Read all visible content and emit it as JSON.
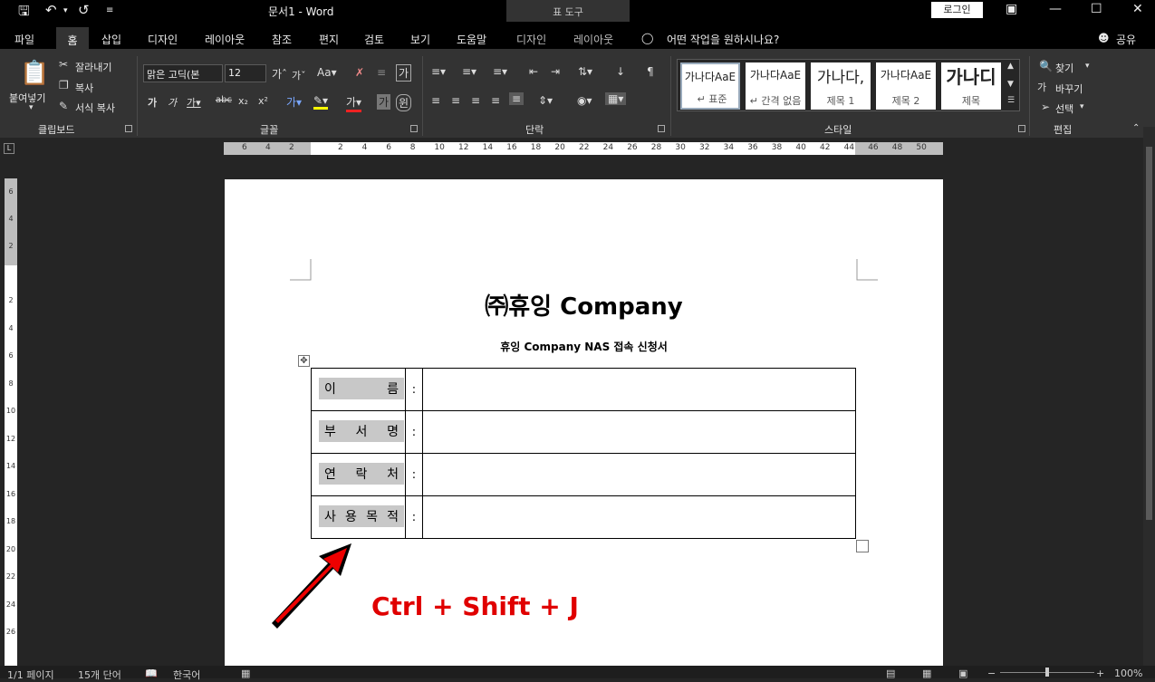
{
  "titlebar": {
    "title": "문서1 - Word",
    "context_tab": "표 도구",
    "login": "로그인"
  },
  "tabs": {
    "file": "파일",
    "home": "홈",
    "insert": "삽입",
    "design": "디자인",
    "layout": "레이아웃",
    "references": "참조",
    "mailings": "편지",
    "review": "검토",
    "view": "보기",
    "help": "도움말",
    "table_design": "디자인",
    "table_layout": "레이아웃",
    "tell_me": "어떤 작업을 원하시나요?",
    "share": "공유"
  },
  "ribbon": {
    "clipboard": {
      "paste": "붙여넣기",
      "cut": "잘라내기",
      "copy": "복사",
      "format_painter": "서식 복사",
      "label": "클립보드"
    },
    "font": {
      "name": "맑은 고딕(본",
      "size": "12",
      "label": "글꼴"
    },
    "paragraph": {
      "label": "단락"
    },
    "styles": {
      "label": "스타일",
      "items": [
        {
          "preview": "가나다AaE",
          "name": "↵ 표준"
        },
        {
          "preview": "가나다AaE",
          "name": "↵ 간격 없음"
        },
        {
          "preview": "가나다,",
          "name": "제목 1"
        },
        {
          "preview": "가나다AaE",
          "name": "제목 2"
        },
        {
          "preview": "가나디",
          "name": "제목"
        }
      ]
    },
    "editing": {
      "find": "찾기",
      "replace": "바꾸기",
      "select": "선택",
      "label": "편집"
    }
  },
  "ruler": {
    "h_left_ticks": [
      "6",
      "4",
      "2"
    ],
    "h_right_ticks": [
      "2",
      "4",
      "6",
      "8",
      "10",
      "12",
      "14",
      "16",
      "18",
      "20",
      "22",
      "24",
      "26",
      "28",
      "30",
      "32",
      "34",
      "36",
      "38",
      "40",
      "42",
      "44",
      "46",
      "48",
      "50"
    ],
    "v_ticks": [
      "6",
      "4",
      "2",
      "2",
      "4",
      "6",
      "8",
      "10",
      "12",
      "14",
      "16",
      "18",
      "20",
      "22",
      "24",
      "26"
    ]
  },
  "document": {
    "title": "㈜휴잉  Company",
    "subtitle": "휴잉 Company NAS 접속 신청서",
    "form_rows": [
      {
        "chars": [
          "이",
          "름"
        ],
        "colon": ":"
      },
      {
        "chars": [
          "부",
          "서",
          "명"
        ],
        "colon": ":"
      },
      {
        "chars": [
          "연",
          "락",
          "처"
        ],
        "colon": ":"
      },
      {
        "chars": [
          "사",
          "용",
          "목",
          "적"
        ],
        "colon": ":"
      }
    ],
    "shortcut_annotation": "Ctrl + Shift + J",
    "annotation_color": "#e00000"
  },
  "statusbar": {
    "page": "1/1 페이지",
    "words": "15개 단어",
    "language": "한국어",
    "zoom": "100%"
  }
}
